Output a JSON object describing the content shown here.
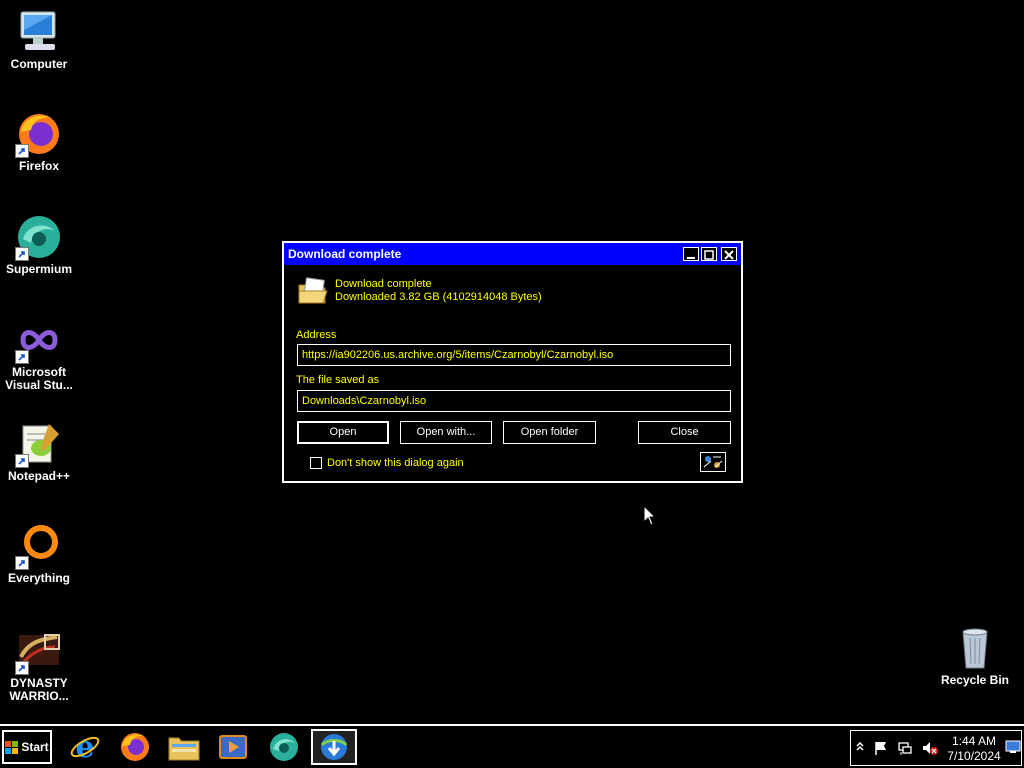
{
  "desktop": {
    "icons": [
      {
        "label": "Computer",
        "icon": "computer-icon"
      },
      {
        "label": "Firefox",
        "icon": "firefox-icon"
      },
      {
        "label": "Supermium",
        "icon": "supermium-icon"
      },
      {
        "label": "Microsoft Visual Stu...",
        "icon": "visual-studio-icon"
      },
      {
        "label": "Notepad++",
        "icon": "notepadpp-icon"
      },
      {
        "label": "Everything",
        "icon": "everything-icon"
      },
      {
        "label": "DYNASTY WARRIO...",
        "icon": "dynasty-warriors-icon"
      },
      {
        "label": "Recycle Bin",
        "icon": "recycle-bin-icon"
      }
    ]
  },
  "dialog": {
    "title": "Download complete",
    "heading": "Download complete",
    "size_text": "Downloaded 3.82  GB (4102914048 Bytes)",
    "address_label": "Address",
    "address_value": "https://ia902206.us.archive.org/5/items/Czarnobyl/Czarnobyl.iso",
    "saved_label": "The file saved as",
    "saved_value": "Downloads\\Czarnobyl.iso",
    "buttons": {
      "open": "Open",
      "open_with": "Open with...",
      "open_folder": "Open folder",
      "close": "Close"
    },
    "dont_show_label": "Don't show this dialog again",
    "dont_show_checked": false
  },
  "taskbar": {
    "start_label": "Start",
    "apps": [
      "internet-explorer-icon",
      "firefox-icon",
      "file-explorer-icon",
      "media-player-icon",
      "supermium-icon",
      "internet-download-manager-icon"
    ],
    "active_app": "internet-download-manager-icon",
    "clock_time": "1:44 AM",
    "clock_date": "7/10/2024"
  },
  "colors": {
    "title_bar": "#0000ff",
    "dialog_text": "#ffff00",
    "background": "#000000"
  }
}
